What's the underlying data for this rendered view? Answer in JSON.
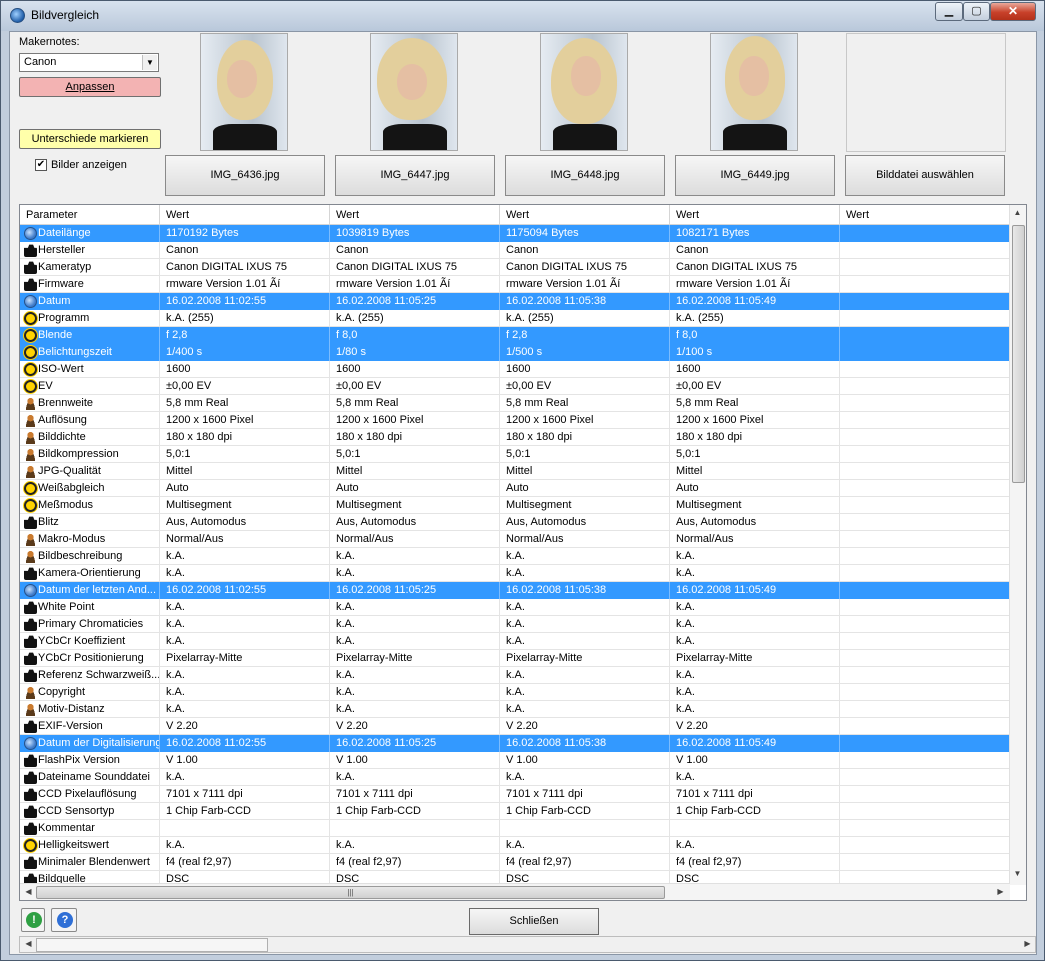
{
  "window": {
    "title": "Bildvergleich",
    "min": "▁",
    "max": "▢",
    "close": "✕"
  },
  "left_panel": {
    "makernotes_label": "Makernotes:",
    "makernotes_value": "Canon",
    "anpassen_label": "Anpassen",
    "markieren_label": "Unterschiede markieren",
    "show_images_label": "Bilder anzeigen",
    "show_images_checked": true
  },
  "files": [
    "IMG_6436.jpg",
    "IMG_6447.jpg",
    "IMG_6448.jpg",
    "IMG_6449.jpg"
  ],
  "select_file_label": "Bilddatei auswählen",
  "table": {
    "headers": [
      "Parameter",
      "Wert",
      "Wert",
      "Wert",
      "Wert",
      "Wert"
    ],
    "rows": [
      {
        "icon": "globe",
        "sel": true,
        "name": "Dateilänge",
        "v": [
          "1170192 Bytes",
          "1039819 Bytes",
          "1175094 Bytes",
          "1082171 Bytes"
        ]
      },
      {
        "icon": "camera",
        "sel": false,
        "name": "Hersteller",
        "v": [
          "Canon",
          "Canon",
          "Canon",
          "Canon"
        ]
      },
      {
        "icon": "camera",
        "sel": false,
        "name": "Kameratyp",
        "v": [
          "Canon DIGITAL IXUS 75",
          "Canon DIGITAL IXUS 75",
          "Canon DIGITAL IXUS 75",
          "Canon DIGITAL IXUS 75"
        ]
      },
      {
        "icon": "camera",
        "sel": false,
        "name": "Firmware",
        "v": [
          "rmware Version 1.01   Ãí",
          "rmware Version 1.01   Ãí",
          "rmware Version 1.01   Ãí",
          "rmware Version 1.01   Ãí"
        ]
      },
      {
        "icon": "globe",
        "sel": true,
        "name": "Datum",
        "v": [
          "16.02.2008 11:02:55",
          "16.02.2008 11:05:25",
          "16.02.2008 11:05:38",
          "16.02.2008 11:05:49"
        ]
      },
      {
        "icon": "gear",
        "sel": false,
        "name": "Programm",
        "v": [
          "k.A. (255)",
          "k.A. (255)",
          "k.A. (255)",
          "k.A. (255)"
        ]
      },
      {
        "icon": "gear",
        "sel": true,
        "name": "Blende",
        "v": [
          "f 2,8",
          "f 8,0",
          "f 2,8",
          "f 8,0"
        ]
      },
      {
        "icon": "gear",
        "sel": true,
        "name": "Belichtungszeit",
        "v": [
          "1/400 s",
          "1/80 s",
          "1/500 s",
          "1/100 s"
        ]
      },
      {
        "icon": "gear",
        "sel": false,
        "name": "ISO-Wert",
        "v": [
          "1600",
          "1600",
          "1600",
          "1600"
        ]
      },
      {
        "icon": "gear",
        "sel": false,
        "name": "EV",
        "v": [
          "±0,00 EV",
          "±0,00 EV",
          "±0,00 EV",
          "±0,00 EV"
        ]
      },
      {
        "icon": "person",
        "sel": false,
        "name": "Brennweite",
        "v": [
          "5,8 mm Real",
          "5,8 mm Real",
          "5,8 mm Real",
          "5,8 mm Real"
        ]
      },
      {
        "icon": "person",
        "sel": false,
        "name": "Auflösung",
        "v": [
          "1200 x 1600 Pixel",
          "1200 x 1600 Pixel",
          "1200 x 1600 Pixel",
          "1200 x 1600 Pixel"
        ]
      },
      {
        "icon": "person",
        "sel": false,
        "name": "Bilddichte",
        "v": [
          "180 x 180 dpi",
          "180 x 180 dpi",
          "180 x 180 dpi",
          "180 x 180 dpi"
        ]
      },
      {
        "icon": "person",
        "sel": false,
        "name": "Bildkompression",
        "v": [
          "5,0:1",
          "5,0:1",
          "5,0:1",
          "5,0:1"
        ]
      },
      {
        "icon": "person",
        "sel": false,
        "name": "JPG-Qualität",
        "v": [
          "Mittel",
          "Mittel",
          "Mittel",
          "Mittel"
        ]
      },
      {
        "icon": "gear",
        "sel": false,
        "name": "Weißabgleich",
        "v": [
          "Auto",
          "Auto",
          "Auto",
          "Auto"
        ]
      },
      {
        "icon": "gear",
        "sel": false,
        "name": "Meßmodus",
        "v": [
          "Multisegment",
          "Multisegment",
          "Multisegment",
          "Multisegment"
        ]
      },
      {
        "icon": "camera",
        "sel": false,
        "name": "Blitz",
        "v": [
          "Aus, Automodus",
          "Aus, Automodus",
          "Aus, Automodus",
          "Aus, Automodus"
        ]
      },
      {
        "icon": "person",
        "sel": false,
        "name": "Makro-Modus",
        "v": [
          "Normal/Aus",
          "Normal/Aus",
          "Normal/Aus",
          "Normal/Aus"
        ]
      },
      {
        "icon": "person",
        "sel": false,
        "name": "Bildbeschreibung",
        "v": [
          "k.A.",
          "k.A.",
          "k.A.",
          "k.A."
        ]
      },
      {
        "icon": "camera",
        "sel": false,
        "name": "Kamera-Orientierung",
        "v": [
          "k.A.",
          "k.A.",
          "k.A.",
          "k.A."
        ]
      },
      {
        "icon": "globe",
        "sel": true,
        "name": "Datum der letzten And...",
        "v": [
          "16.02.2008 11:02:55",
          "16.02.2008 11:05:25",
          "16.02.2008 11:05:38",
          "16.02.2008 11:05:49"
        ]
      },
      {
        "icon": "camera",
        "sel": false,
        "name": "White Point",
        "v": [
          "k.A.",
          "k.A.",
          "k.A.",
          "k.A."
        ]
      },
      {
        "icon": "camera",
        "sel": false,
        "name": "Primary Chromaticies",
        "v": [
          "k.A.",
          "k.A.",
          "k.A.",
          "k.A."
        ]
      },
      {
        "icon": "camera",
        "sel": false,
        "name": "YCbCr Koeffizient",
        "v": [
          "k.A.",
          "k.A.",
          "k.A.",
          "k.A."
        ]
      },
      {
        "icon": "camera",
        "sel": false,
        "name": "YCbCr Positionierung",
        "v": [
          "Pixelarray-Mitte",
          "Pixelarray-Mitte",
          "Pixelarray-Mitte",
          "Pixelarray-Mitte"
        ]
      },
      {
        "icon": "camera",
        "sel": false,
        "name": "Referenz Schwarzweiß...",
        "v": [
          "k.A.",
          "k.A.",
          "k.A.",
          "k.A."
        ]
      },
      {
        "icon": "person",
        "sel": false,
        "name": "Copyright",
        "v": [
          "k.A.",
          "k.A.",
          "k.A.",
          "k.A."
        ]
      },
      {
        "icon": "person",
        "sel": false,
        "name": "Motiv-Distanz",
        "v": [
          "k.A.",
          "k.A.",
          "k.A.",
          "k.A."
        ]
      },
      {
        "icon": "camera",
        "sel": false,
        "name": "EXIF-Version",
        "v": [
          "V 2.20",
          "V 2.20",
          "V 2.20",
          "V 2.20"
        ]
      },
      {
        "icon": "globe",
        "sel": true,
        "name": "Datum der Digitalisierung",
        "v": [
          "16.02.2008 11:02:55",
          "16.02.2008 11:05:25",
          "16.02.2008 11:05:38",
          "16.02.2008 11:05:49"
        ]
      },
      {
        "icon": "camera",
        "sel": false,
        "name": "FlashPix Version",
        "v": [
          "V 1.00",
          "V 1.00",
          "V 1.00",
          "V 1.00"
        ]
      },
      {
        "icon": "camera",
        "sel": false,
        "name": "Dateiname Sounddatei",
        "v": [
          "k.A.",
          "k.A.",
          "k.A.",
          "k.A."
        ]
      },
      {
        "icon": "camera",
        "sel": false,
        "name": "CCD Pixelauflösung",
        "v": [
          "7101 x 7111 dpi",
          "7101 x 7111 dpi",
          "7101 x 7111 dpi",
          "7101 x 7111 dpi"
        ]
      },
      {
        "icon": "camera",
        "sel": false,
        "name": "CCD Sensortyp",
        "v": [
          "1 Chip Farb-CCD",
          "1 Chip Farb-CCD",
          "1 Chip Farb-CCD",
          "1 Chip Farb-CCD"
        ]
      },
      {
        "icon": "camera",
        "sel": false,
        "name": "Kommentar",
        "v": [
          "",
          "",
          "",
          ""
        ]
      },
      {
        "icon": "gear",
        "sel": false,
        "name": "Helligkeitswert",
        "v": [
          "k.A.",
          "k.A.",
          "k.A.",
          "k.A."
        ]
      },
      {
        "icon": "camera",
        "sel": false,
        "name": "Minimaler Blendenwert",
        "v": [
          "f4 (real f2,97)",
          "f4 (real f2,97)",
          "f4 (real f2,97)",
          "f4 (real f2,97)"
        ]
      },
      {
        "icon": "camera",
        "sel": false,
        "name": "Bildquelle",
        "v": [
          "DSC",
          "DSC",
          "DSC",
          "DSC"
        ]
      }
    ]
  },
  "close_button_label": "Schließen",
  "colors": {
    "selection": "#3399ff",
    "anpassen": "#f3b3b3",
    "markieren": "#ffffaa"
  }
}
